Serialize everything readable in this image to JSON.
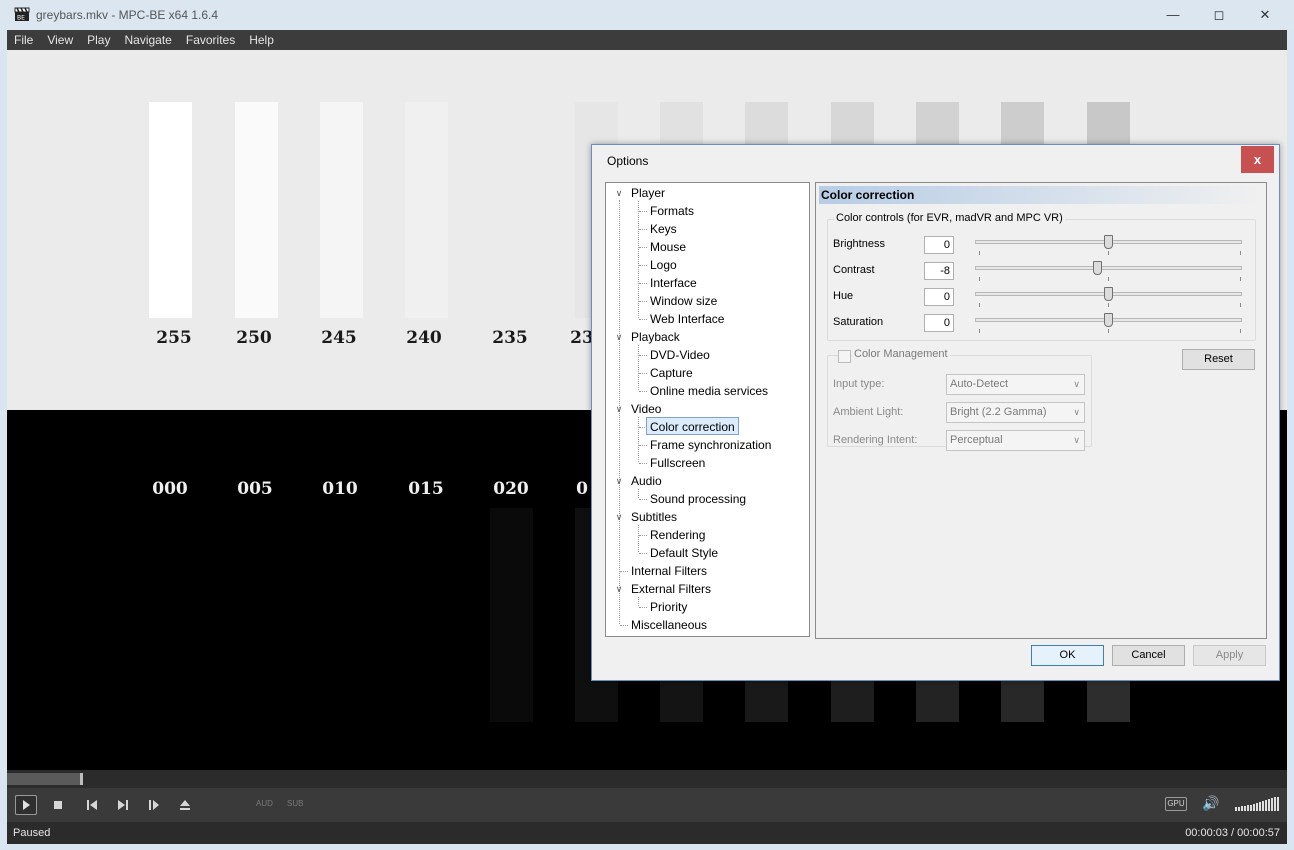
{
  "window": {
    "title": "greybars.mkv - MPC-BE x64 1.6.4",
    "minimize": "—",
    "maximize": "◻",
    "close": "✕"
  },
  "menu": {
    "items": [
      "File",
      "View",
      "Play",
      "Navigate",
      "Favorites",
      "Help"
    ]
  },
  "video": {
    "top_labels": [
      "255",
      "250",
      "245",
      "240",
      "235",
      "23"
    ],
    "bottom_labels": [
      "000",
      "005",
      "010",
      "015",
      "020",
      "0"
    ]
  },
  "controls": {
    "aud": "AUD",
    "sub": "SUB",
    "gpu": "GPU"
  },
  "status": {
    "text": "Paused",
    "time": "00:00:03 / 00:00:57"
  },
  "dialog": {
    "title": "Options",
    "close": "x",
    "tree": [
      "Player",
      "Formats",
      "Keys",
      "Mouse",
      "Logo",
      "Interface",
      "Window size",
      "Web Interface",
      "Playback",
      "DVD-Video",
      "Capture",
      "Online media services",
      "Video",
      "Color correction",
      "Frame synchronization",
      "Fullscreen",
      "Audio",
      "Sound processing",
      "Subtitles",
      "Rendering",
      "Default Style",
      "Internal Filters",
      "External Filters",
      "Priority",
      "Miscellaneous"
    ],
    "selected": "Color correction",
    "panel_title": "Color correction",
    "color_controls": {
      "title": "Color controls (for EVR, madVR and MPC VR)",
      "sliders": [
        {
          "label": "Brightness",
          "value": "0",
          "fraction": 0.5
        },
        {
          "label": "Contrast",
          "value": "-8",
          "fraction": 0.46
        },
        {
          "label": "Hue",
          "value": "0",
          "fraction": 0.5
        },
        {
          "label": "Saturation",
          "value": "0",
          "fraction": 0.5
        }
      ]
    },
    "reset": "Reset",
    "color_management": {
      "title": "Color Management",
      "rows": [
        {
          "label": "Input type:",
          "value": "Auto-Detect"
        },
        {
          "label": "Ambient Light:",
          "value": "Bright (2.2 Gamma)"
        },
        {
          "label": "Rendering Intent:",
          "value": "Perceptual"
        }
      ]
    },
    "buttons": {
      "ok": "OK",
      "cancel": "Cancel",
      "apply": "Apply"
    }
  }
}
